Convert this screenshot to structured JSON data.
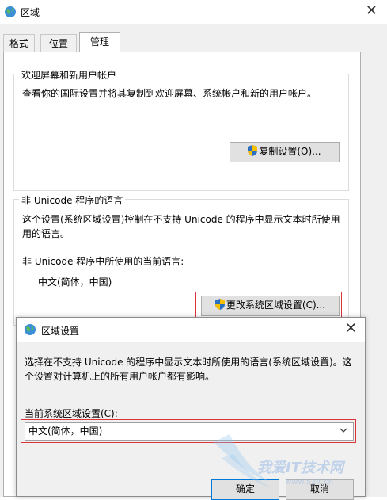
{
  "window": {
    "title": "区域",
    "close_glyph": "✕"
  },
  "tabs": [
    {
      "label": "格式"
    },
    {
      "label": "位置"
    },
    {
      "label": "管理",
      "active": true
    }
  ],
  "welcome": {
    "title": "欢迎屏幕和新用户帐户",
    "description": "查看你的国际设置并将其复制到欢迎屏幕、系统帐户和新的用户帐户。",
    "copy_button": "复制设置(O)..."
  },
  "unicode": {
    "title": "非 Unicode 程序的语言",
    "description_line1": "这个设置(系统区域设置)控制在不支持 Unicode 的程序中显示文本时所使用",
    "description_line2": "用的语言。",
    "current_label": "非 Unicode 程序中所使用的当前语言:",
    "current_value": "中文(简体，中国)",
    "change_button": "更改系统区域设置(C)..."
  },
  "dialog": {
    "title": "区域设置",
    "close_glyph": "✕",
    "description_line1": "选择在不支持 Unicode 的程序中显示文本时所使用的语言(系统区域设置)。这",
    "description_line2": "个设置对计算机上的所有用户帐户都有影响。",
    "select_label": "当前系统区域设置(C):",
    "select_value": "中文(简体，中国)",
    "ok_button": "确定",
    "cancel_button": "取消"
  },
  "watermark": {
    "text": "我爱IT技术网",
    "url": "www.52it.cn"
  },
  "colors": {
    "highlight_red": "#d9343a",
    "button_face": "#e1e1e1",
    "window_bg": "#f0f0f0"
  }
}
